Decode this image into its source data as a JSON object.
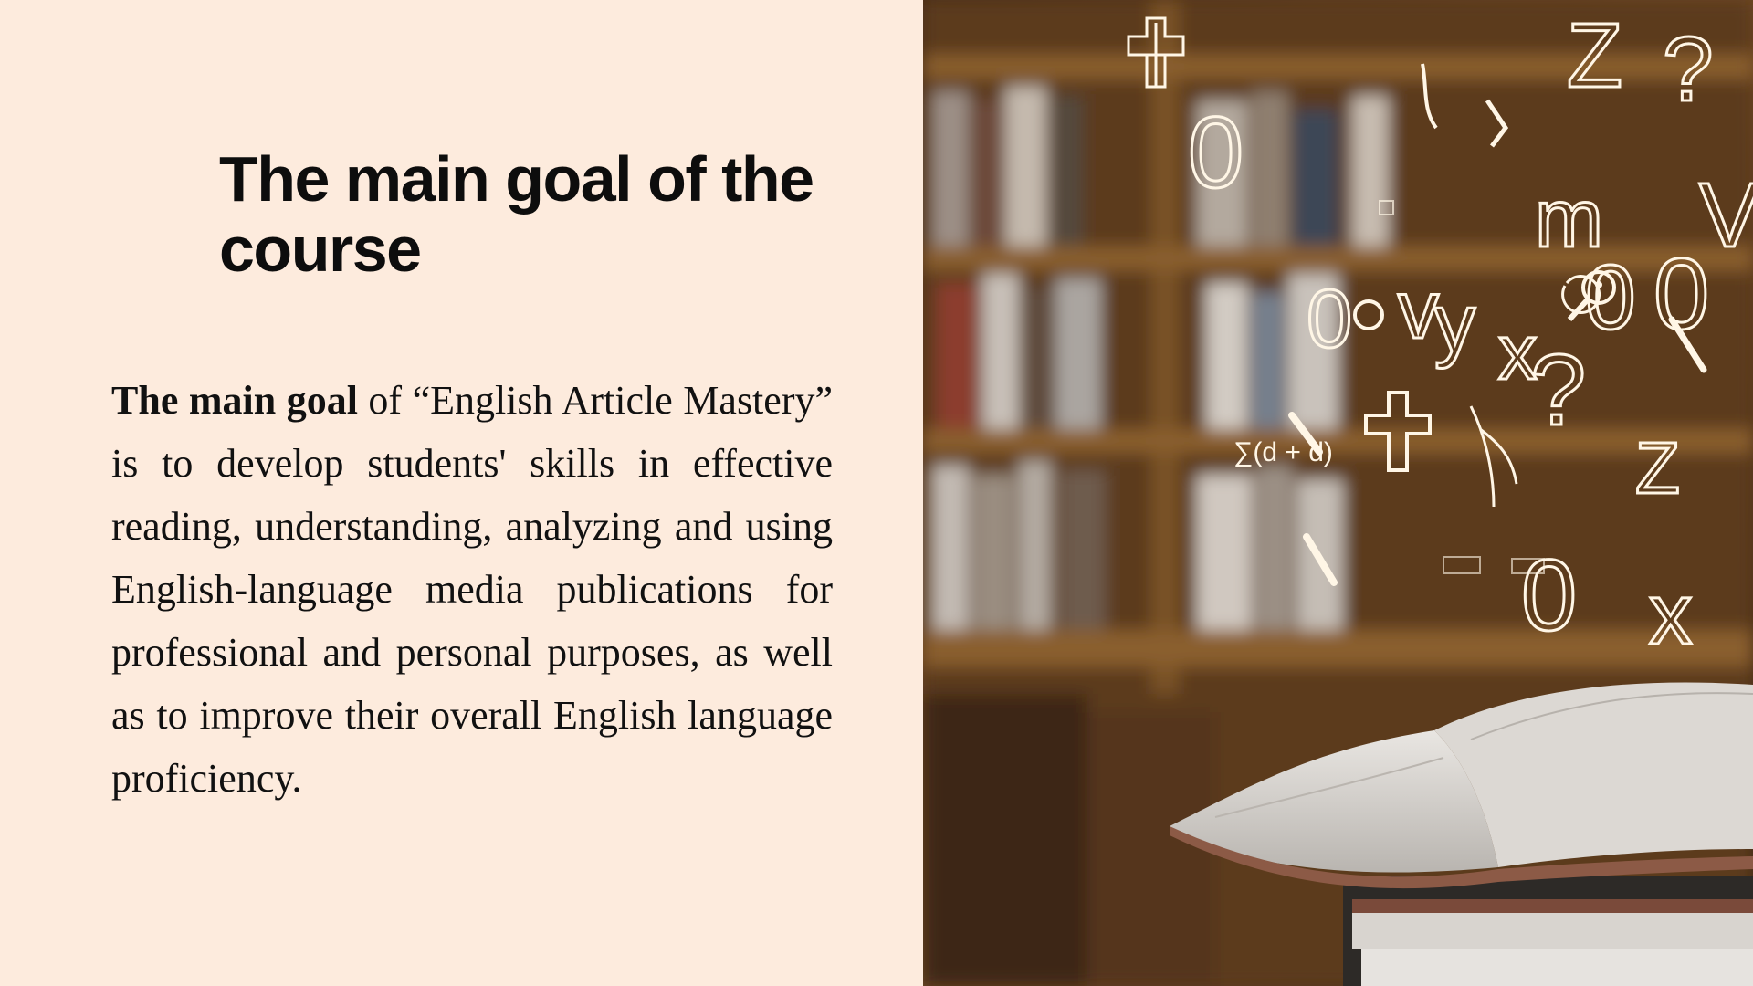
{
  "slide": {
    "title": "The main goal of the course",
    "body": {
      "bold_lead": "The main goal",
      "text": " of “English Article Mastery” is to develop students' skills in effective reading, understanding, analyzing and using English-language media publications for professional and personal purposes, as well as to improve their overall English language proficiency."
    }
  },
  "image": {
    "icon": "library-books-with-floating-symbols-photo",
    "colors": {
      "background": "#fdebdd",
      "shelf_wood": "#6b4520",
      "glyph": "#fff6e6"
    }
  }
}
